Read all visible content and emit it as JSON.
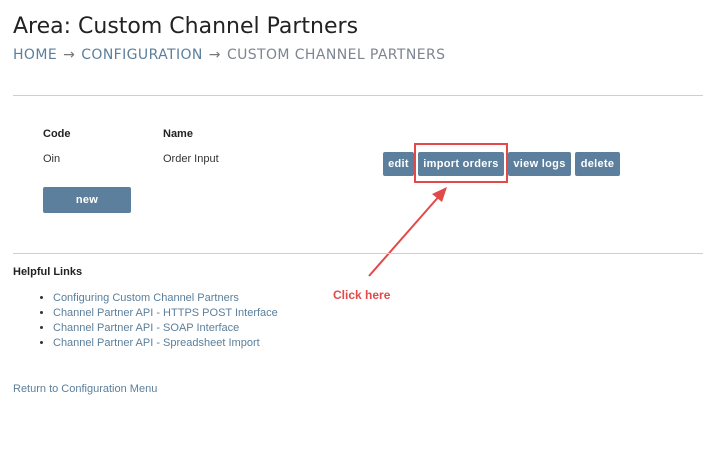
{
  "page": {
    "title": "Area: Custom Channel Partners",
    "breadcrumb": [
      "HOME",
      "CONFIGURATION",
      "CUSTOM CHANNEL PARTNERS"
    ],
    "separator": "→"
  },
  "table": {
    "headers": [
      "Code",
      "Name"
    ],
    "rows": [
      {
        "code": "Oin",
        "name": "Order Input",
        "actions": [
          "edit",
          "import orders",
          "view logs",
          "delete"
        ]
      }
    ],
    "new_label": "new"
  },
  "annotation": {
    "text": "Click here",
    "color": "#e24a4a"
  },
  "helpful": {
    "title": "Helpful Links",
    "links": [
      "Configuring Custom Channel Partners",
      "Channel Partner API - HTTPS POST Interface",
      "Channel Partner API - SOAP Interface",
      "Channel Partner API - Spreadsheet Import"
    ]
  },
  "return_link": "Return to Configuration Menu",
  "colors": {
    "accent": "#5b7f9c",
    "highlight": "#e24a4a"
  }
}
